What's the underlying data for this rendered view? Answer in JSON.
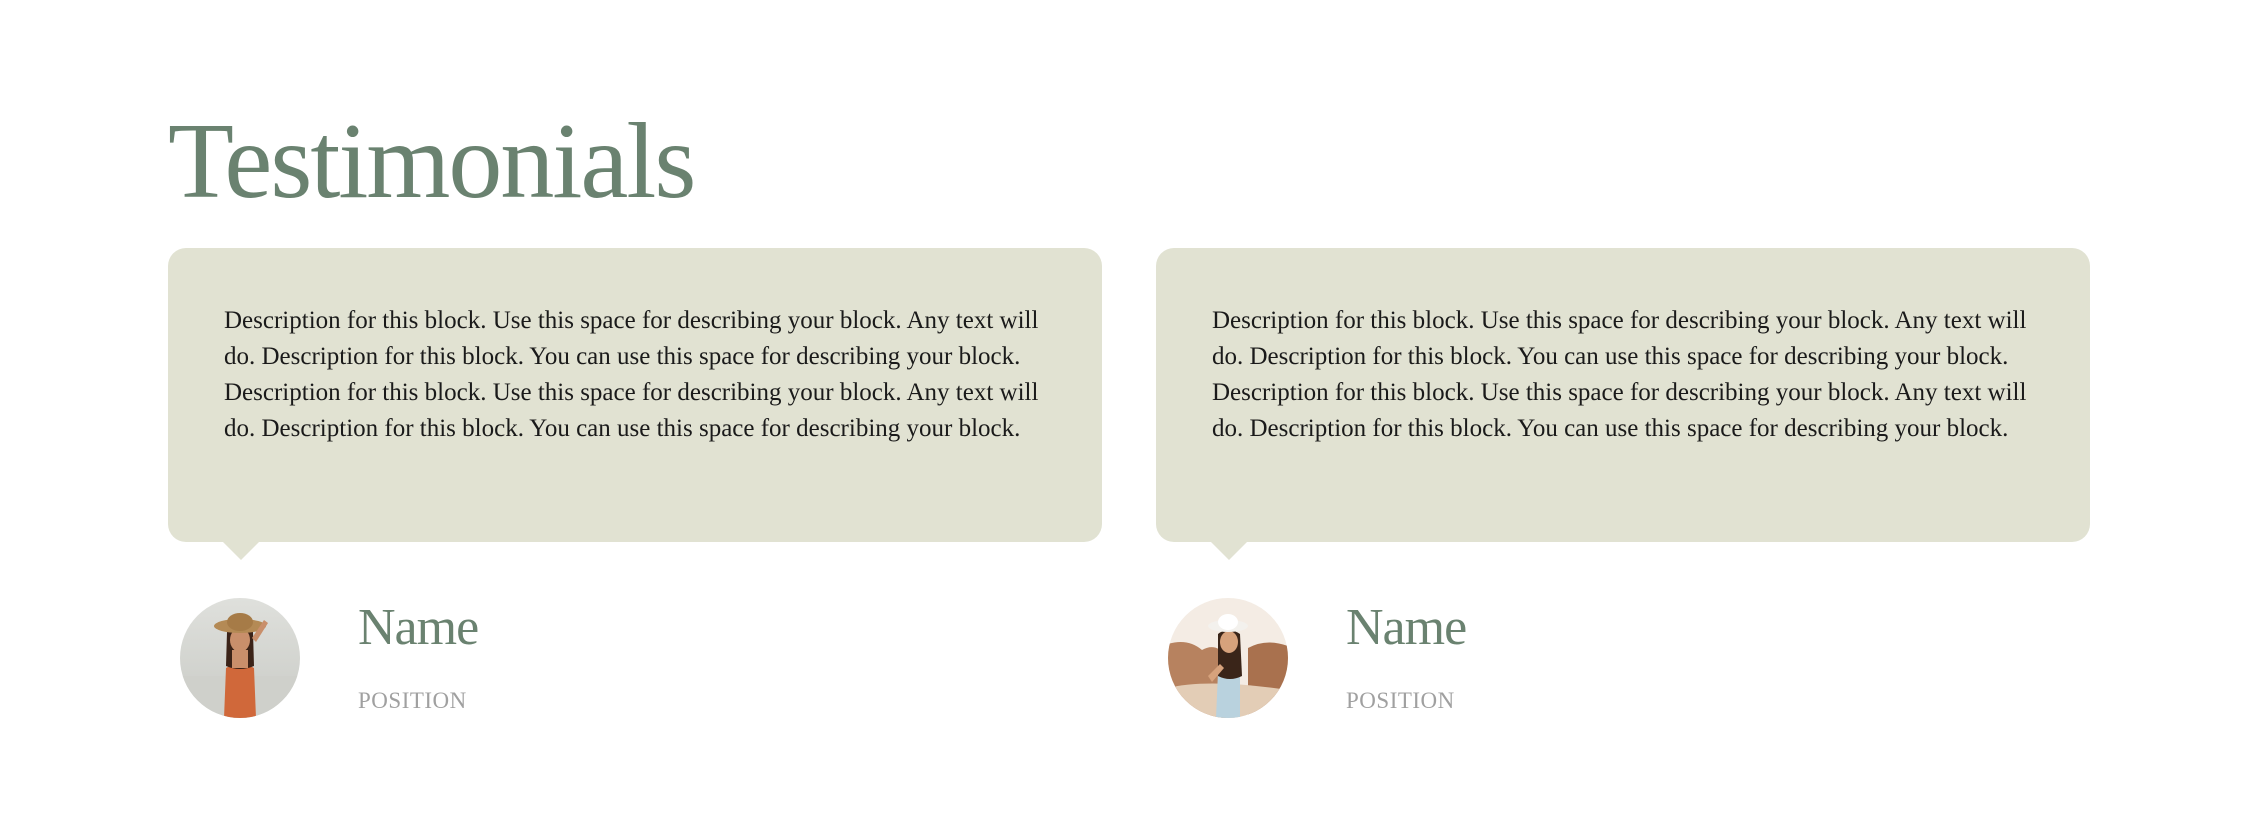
{
  "page": {
    "title": "Testimonials"
  },
  "colors": {
    "accent": "#6a8270",
    "bubble_bg": "#e1e2d2",
    "body_text": "#1a1a1a",
    "muted_text": "#a0a0a0"
  },
  "testimonials": [
    {
      "text": "Description for this block. Use this space for describing your block. Any text will do. Description for this block. You can use this space for describing your block. Description for this block. Use this space for describing your block. Any text will do. Description for this block. You can use this space for describing your block.",
      "name": "Name",
      "position": "POSITION",
      "avatar_icon": "woman-straw-hat-avatar"
    },
    {
      "text": "Description for this block. Use this space for describing your block. Any text will do. Description for this block. You can use this space for describing your block. Description for this block. Use this space for describing your block. Any text will do. Description for this block. You can use this space for describing your block.",
      "name": "Name",
      "position": "POSITION",
      "avatar_icon": "woman-white-hat-avatar"
    }
  ]
}
